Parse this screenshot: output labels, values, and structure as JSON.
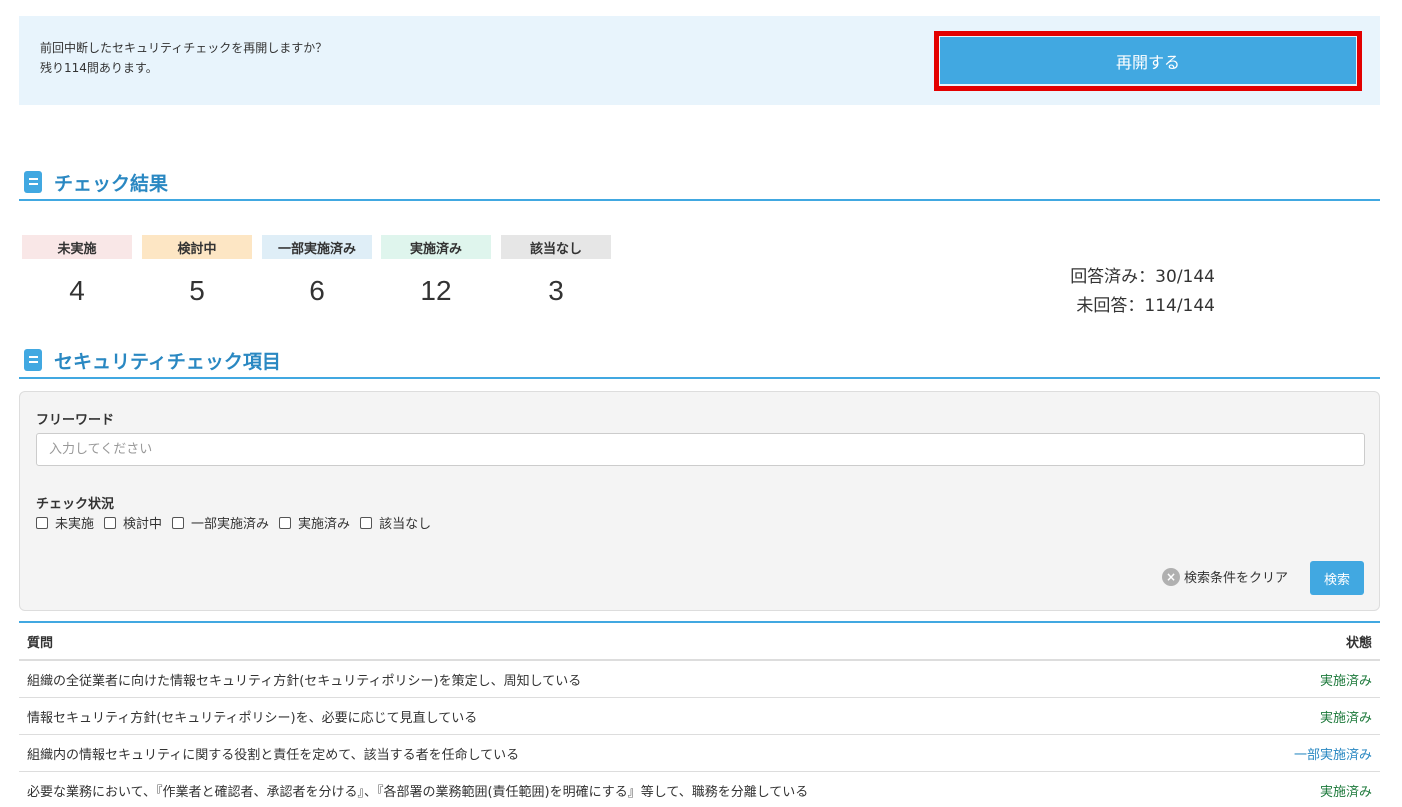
{
  "resume": {
    "message_line1": "前回中断したセキュリティチェックを再開しますか？",
    "message_line2": "残り114問あります。",
    "button_label": "再開する"
  },
  "results": {
    "title": "チェック結果",
    "stats": [
      {
        "label": "未実施",
        "count": "4",
        "color": "#f9e7e7"
      },
      {
        "label": "検討中",
        "count": "5",
        "color": "#fde6c4"
      },
      {
        "label": "一部実施済み",
        "count": "6",
        "color": "#dfeef7"
      },
      {
        "label": "実施済み",
        "count": "12",
        "color": "#dff5ed"
      },
      {
        "label": "該当なし",
        "count": "3",
        "color": "#e6e6e6"
      }
    ],
    "answered": "回答済み：30/144",
    "unanswered": "未回答：114/144"
  },
  "items": {
    "title": "セキュリティチェック項目",
    "search": {
      "freeword_label": "フリーワード",
      "freeword_placeholder": "入力してください",
      "freeword_value": "",
      "status_label": "チェック状況",
      "status_options": [
        "未実施",
        "検討中",
        "一部実施済み",
        "実施済み",
        "該当なし"
      ],
      "clear_label": "検索条件をクリア",
      "search_button": "検索"
    },
    "table": {
      "col_question": "質問",
      "col_status": "状態",
      "rows": [
        {
          "question": "組織の全従業者に向けた情報セキュリティ方針(セキュリティポリシー)を策定し、周知している",
          "status": "実施済み"
        },
        {
          "question": "情報セキュリティ方針(セキュリティポリシー)を、必要に応じて見直している",
          "status": "実施済み"
        },
        {
          "question": "組織内の情報セキュリティに関する役割と責任を定めて、該当する者を任命している",
          "status": "一部実施済み"
        },
        {
          "question": "必要な業務において、『作業者と確認者、承認者を分ける』、『各部署の業務範囲(責任範囲)を明確にする』等して、職務を分離している",
          "status": "実施済み"
        }
      ]
    }
  },
  "colors": {
    "accent": "#41a8e1",
    "heading": "#2a88c2",
    "highlight": "#e30000",
    "done_status": "#1e7a3c"
  }
}
